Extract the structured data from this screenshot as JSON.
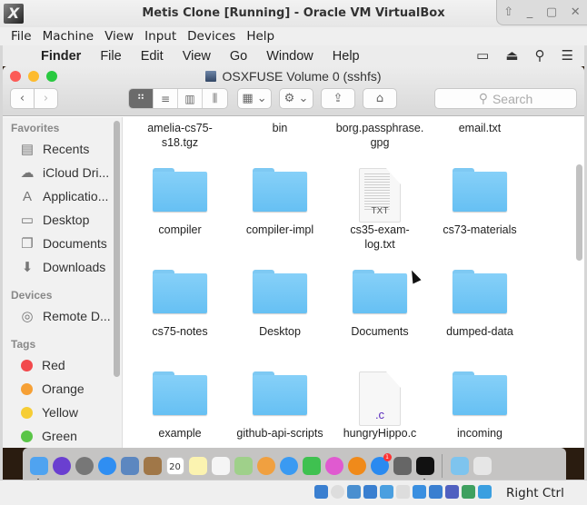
{
  "vbox": {
    "title": "Metis Clone [Running] - Oracle VM VirtualBox",
    "window_controls": [
      "pin-icon",
      "minimize-icon",
      "maximize-icon",
      "close-icon"
    ],
    "menu": [
      "File",
      "Machine",
      "View",
      "Input",
      "Devices",
      "Help"
    ],
    "status_icons": [
      "hard-disk-icon",
      "optical-drive-icon",
      "audio-icon",
      "network-icon",
      "usb-icon",
      "shared-folder-icon",
      "display-icon",
      "video-capture-icon",
      "cpu-activity-icon",
      "guest-additions-icon",
      "mouse-integration-icon"
    ],
    "host_key": "Right Ctrl"
  },
  "mac_menubar": {
    "apple": "",
    "app": "Finder",
    "items": [
      "File",
      "Edit",
      "View",
      "Go",
      "Window",
      "Help"
    ],
    "right_icons": [
      "airplay-displays-icon",
      "eject-icon",
      "spotlight-icon",
      "notification-list-icon"
    ]
  },
  "finder": {
    "title": "OSXFUSE Volume 0 (sshfs)",
    "nav": {
      "back": "‹",
      "forward": "›"
    },
    "view_modes": [
      "icon-view",
      "list-view",
      "column-view",
      "gallery-view"
    ],
    "active_view": "icon-view",
    "search_placeholder": "Search",
    "sidebar": {
      "favorites_label": "Favorites",
      "favorites": [
        {
          "label": "Recents",
          "icon": "recents-icon"
        },
        {
          "label": "iCloud Dri...",
          "icon": "cloud-icon"
        },
        {
          "label": "Applicatio...",
          "icon": "applications-icon"
        },
        {
          "label": "Desktop",
          "icon": "desktop-icon"
        },
        {
          "label": "Documents",
          "icon": "documents-icon"
        },
        {
          "label": "Downloads",
          "icon": "downloads-icon"
        }
      ],
      "devices_label": "Devices",
      "devices": [
        {
          "label": "Remote D...",
          "icon": "disc-icon"
        }
      ],
      "tags_label": "Tags",
      "tags": [
        {
          "label": "Red",
          "color": "#f2494c"
        },
        {
          "label": "Orange",
          "color": "#f6a035"
        },
        {
          "label": "Yellow",
          "color": "#f6cd35"
        },
        {
          "label": "Green",
          "color": "#5ac547"
        }
      ]
    },
    "files": [
      {
        "name": "amelia-cs75-",
        "name2": "s18.tgz",
        "kind": "partial"
      },
      {
        "name": "bin",
        "name2": "",
        "kind": "partial"
      },
      {
        "name": "borg.passphrase.",
        "name2": "gpg",
        "kind": "partial"
      },
      {
        "name": "email.txt",
        "name2": "",
        "kind": "partial"
      },
      {
        "name": "compiler",
        "name2": "",
        "kind": "folder"
      },
      {
        "name": "compiler-impl",
        "name2": "",
        "kind": "folder"
      },
      {
        "name": "cs35-exam-",
        "name2": "log.txt",
        "kind": "txt",
        "ext": "TXT"
      },
      {
        "name": "cs73-materials",
        "name2": "",
        "kind": "folder"
      },
      {
        "name": "cs75-notes",
        "name2": "",
        "kind": "folder"
      },
      {
        "name": "Desktop",
        "name2": "",
        "kind": "folder"
      },
      {
        "name": "Documents",
        "name2": "",
        "kind": "folder"
      },
      {
        "name": "dumped-data",
        "name2": "",
        "kind": "folder"
      },
      {
        "name": "example",
        "name2": "",
        "kind": "folder"
      },
      {
        "name": "github-api-scripts",
        "name2": "",
        "kind": "folder"
      },
      {
        "name": "hungryHippo.c",
        "name2": "",
        "kind": "c",
        "ext": ".c"
      },
      {
        "name": "incoming",
        "name2": "",
        "kind": "folder"
      }
    ]
  },
  "dock": {
    "apps": [
      {
        "name": "finder",
        "color": "#4fa3f0",
        "running": true
      },
      {
        "name": "siri",
        "color": "#6a3fd0"
      },
      {
        "name": "launchpad",
        "color": "#777"
      },
      {
        "name": "safari",
        "color": "#2f8ef2"
      },
      {
        "name": "mail-preview",
        "color": "#5c87c0"
      },
      {
        "name": "contacts",
        "color": "#a07748"
      },
      {
        "name": "calendar",
        "color": "#ffffff",
        "label": "20"
      },
      {
        "name": "notes",
        "color": "#fbf3b0"
      },
      {
        "name": "reminders",
        "color": "#f5f5f5"
      },
      {
        "name": "maps",
        "color": "#9fd08a"
      },
      {
        "name": "photos",
        "color": "#f0a040"
      },
      {
        "name": "messages",
        "color": "#3a9af2"
      },
      {
        "name": "facetime",
        "color": "#3fc150"
      },
      {
        "name": "itunes",
        "color": "#e05ad0"
      },
      {
        "name": "ibooks",
        "color": "#f08a1a"
      },
      {
        "name": "app-store",
        "color": "#2a8af0",
        "badge": "1"
      },
      {
        "name": "system-preferences",
        "color": "#666"
      },
      {
        "name": "terminal",
        "color": "#111",
        "running": true
      }
    ],
    "extras": [
      {
        "name": "downloads-stack",
        "color": "#7ec4ee"
      },
      {
        "name": "trash",
        "color": "#e6e6e6"
      }
    ]
  }
}
